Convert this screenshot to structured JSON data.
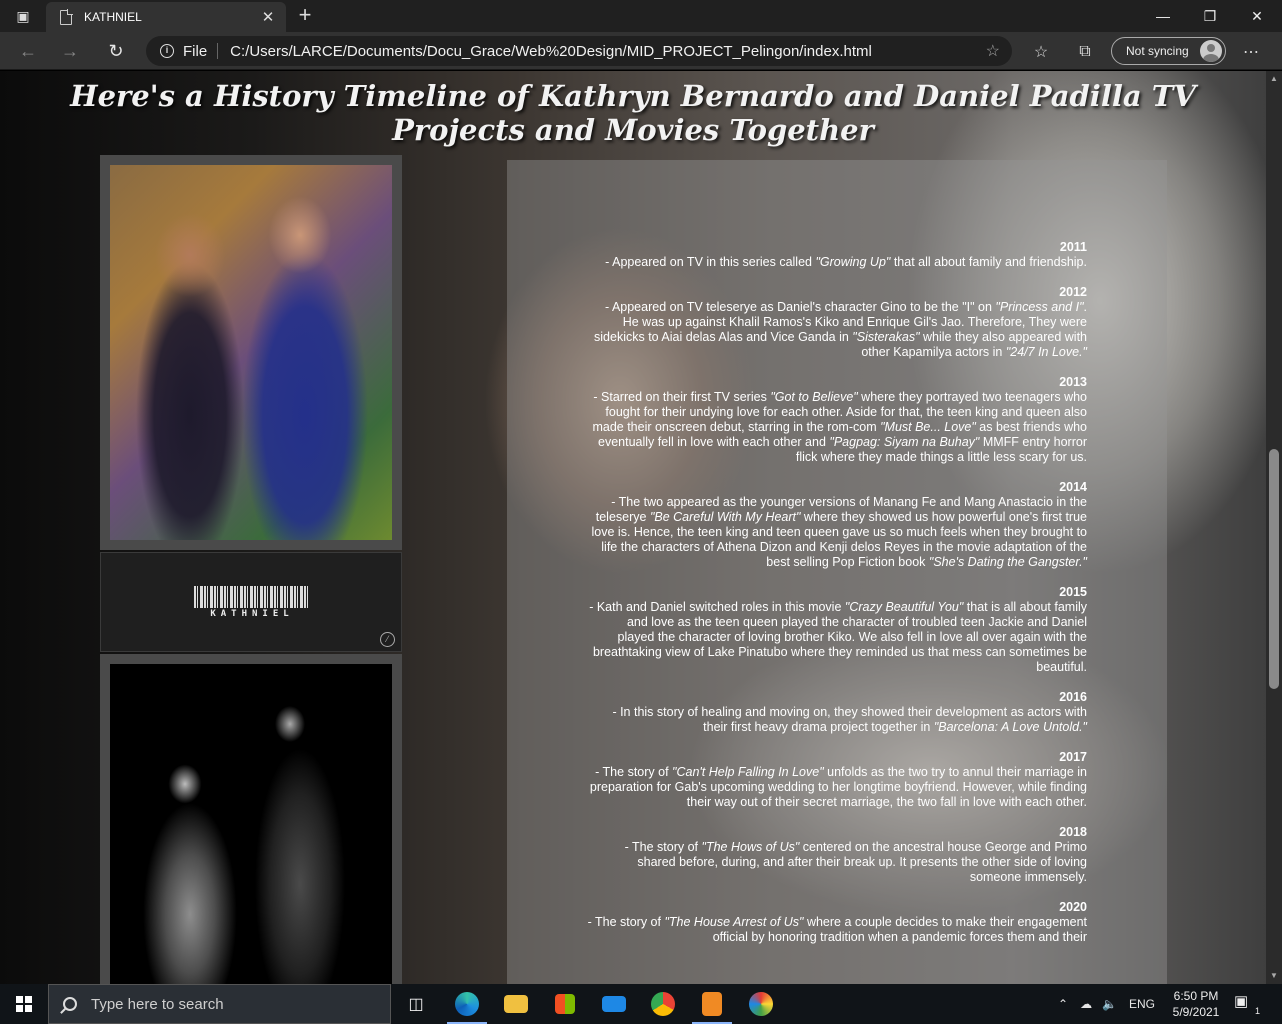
{
  "browser": {
    "tab_title": "KATHNIEL",
    "address_scheme": "File",
    "url": "C:/Users/LARCE/Documents/Docu_Grace/Web%20Design/MID_PROJECT_Pelingon/index.html",
    "sync_label": "Not syncing"
  },
  "page": {
    "headline": "Here's a History Timeline of Kathryn Bernardo and Daniel Padilla TV Projects and Movies Together",
    "barcode_text": "KATHNIEL",
    "timeline": [
      {
        "year": "2011",
        "segments": [
          {
            "t": "- Appeared on TV in this series called ",
            "i": false
          },
          {
            "t": "\"Growing Up\"",
            "i": true
          },
          {
            "t": " that all about family and friendship.",
            "i": false
          }
        ]
      },
      {
        "year": "2012",
        "segments": [
          {
            "t": "- Appeared on TV teleserye as Daniel's character Gino to be the \"I\" on ",
            "i": false
          },
          {
            "t": "\"Princess and I\"",
            "i": true
          },
          {
            "t": ". He was up against Khalil Ramos's Kiko and Enrique Gil's Jao. Therefore, They were sidekicks to Aiai delas Alas and Vice Ganda in ",
            "i": false
          },
          {
            "t": "\"Sisterakas\"",
            "i": true
          },
          {
            "t": " while they also appeared with other Kapamilya actors in ",
            "i": false
          },
          {
            "t": "\"24/7 In Love.\"",
            "i": true
          }
        ]
      },
      {
        "year": "2013",
        "segments": [
          {
            "t": "- Starred on their first TV series ",
            "i": false
          },
          {
            "t": "\"Got to Believe\"",
            "i": true
          },
          {
            "t": " where they portrayed two teenagers who fought for their undying love for each other. Aside for that, the teen king and queen also made their onscreen debut, starring in the rom-com ",
            "i": false
          },
          {
            "t": "\"Must Be... Love\"",
            "i": true
          },
          {
            "t": " as best friends who eventually fell in love with each other and ",
            "i": false
          },
          {
            "t": "\"Pagpag: Siyam na Buhay\"",
            "i": true
          },
          {
            "t": " MMFF entry horror flick where they made things a little less scary for us.",
            "i": false
          }
        ]
      },
      {
        "year": "2014",
        "segments": [
          {
            "t": "- The two appeared as the younger versions of Manang Fe and Mang Anastacio in the teleserye ",
            "i": false
          },
          {
            "t": "\"Be Careful With My Heart\"",
            "i": true
          },
          {
            "t": " where they showed us how powerful one's first true love is. Hence, the teen king and teen queen gave us so much feels when they brought to life the characters of Athena Dizon and Kenji delos Reyes in the movie adaptation of the best selling Pop Fiction book ",
            "i": false
          },
          {
            "t": "\"She's Dating the Gangster.\"",
            "i": true
          }
        ]
      },
      {
        "year": "2015",
        "segments": [
          {
            "t": "- Kath and Daniel switched roles in this movie ",
            "i": false
          },
          {
            "t": "\"Crazy Beautiful You\"",
            "i": true
          },
          {
            "t": " that is all about family and love as the teen queen played the character of troubled teen Jackie and Daniel played the character of loving brother Kiko. We also fell in love all over again with the breathtaking view of Lake Pinatubo where they reminded us that mess can sometimes be beautiful.",
            "i": false
          }
        ]
      },
      {
        "year": "2016",
        "segments": [
          {
            "t": "- In this story of healing and moving on, they showed their development as actors with their first heavy drama project together in ",
            "i": false
          },
          {
            "t": "\"Barcelona: A Love Untold.\"",
            "i": true
          }
        ]
      },
      {
        "year": "2017",
        "segments": [
          {
            "t": "- The story of ",
            "i": false
          },
          {
            "t": "\"Can't Help Falling In Love\"",
            "i": true
          },
          {
            "t": " unfolds as the two try to annul their marriage in preparation for Gab's upcoming wedding to her longtime boyfriend. However, while finding their way out of their secret marriage, the two fall in love with each other.",
            "i": false
          }
        ]
      },
      {
        "year": "2018",
        "segments": [
          {
            "t": "- The story of ",
            "i": false
          },
          {
            "t": "\"The Hows of Us\"",
            "i": true
          },
          {
            "t": " centered on the ancestral house George and Primo shared before, during, and after their break up. It presents the other side of loving someone immensely.",
            "i": false
          }
        ]
      },
      {
        "year": "2020",
        "segments": [
          {
            "t": "- The story of ",
            "i": false
          },
          {
            "t": "\"The House Arrest of Us\"",
            "i": true
          },
          {
            "t": " where a couple decides to make their engagement official by honoring tradition when a pandemic forces them and their",
            "i": false
          }
        ]
      }
    ]
  },
  "taskbar": {
    "search_placeholder": "Type here to search",
    "language": "ENG",
    "time": "6:50 PM",
    "date": "5/9/2021",
    "notification_count": "1"
  }
}
